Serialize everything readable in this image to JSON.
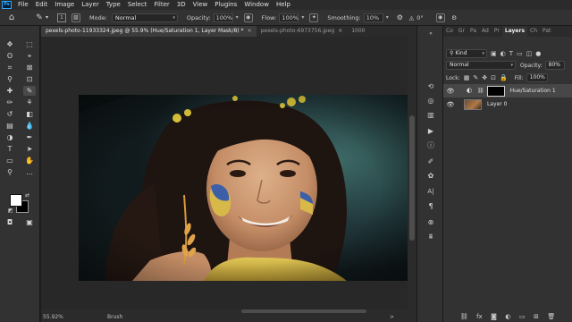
{
  "app": {
    "logo": "Ps"
  },
  "menu": [
    "File",
    "Edit",
    "Image",
    "Layer",
    "Type",
    "Select",
    "Filter",
    "3D",
    "View",
    "Plugins",
    "Window",
    "Help"
  ],
  "options": {
    "mode_label": "Mode:",
    "mode_value": "Normal",
    "opacity_label": "Opacity:",
    "opacity_value": "100%",
    "flow_label": "Flow:",
    "flow_value": "100%",
    "smoothing_label": "Smoothing:",
    "smoothing_value": "10%",
    "angle_value": "0°",
    "brush_size": "1"
  },
  "tabs": [
    {
      "label": "pexels-photo-11933324.jpeg @ 55.9% (Hue/Saturation 1, Layer Mask/8) *",
      "active": true
    },
    {
      "label": "pexels-photo-6973756.jpeg",
      "active": false
    },
    {
      "label": "1000",
      "active": false
    }
  ],
  "status": {
    "zoom": "55.92%",
    "tool": "Brush",
    "arrow": ">"
  },
  "panel_tabs": [
    "Co",
    "Gr",
    "Pa",
    "Ad",
    "Pr",
    "Layers",
    "Ch",
    "Pat"
  ],
  "layers_panel": {
    "filter_kind": "Kind",
    "blend_mode": "Normal",
    "opacity_label": "Opacity:",
    "opacity_value": "80%",
    "lock_label": "Lock:",
    "fill_label": "Fill:",
    "fill_value": "100%",
    "layers": [
      {
        "name": "Hue/Saturation 1",
        "selected": true
      },
      {
        "name": "Layer 0",
        "selected": false
      }
    ]
  },
  "colors": {
    "foreground": "#ffffff",
    "background": "#000000",
    "accent": "#31a8ff"
  }
}
